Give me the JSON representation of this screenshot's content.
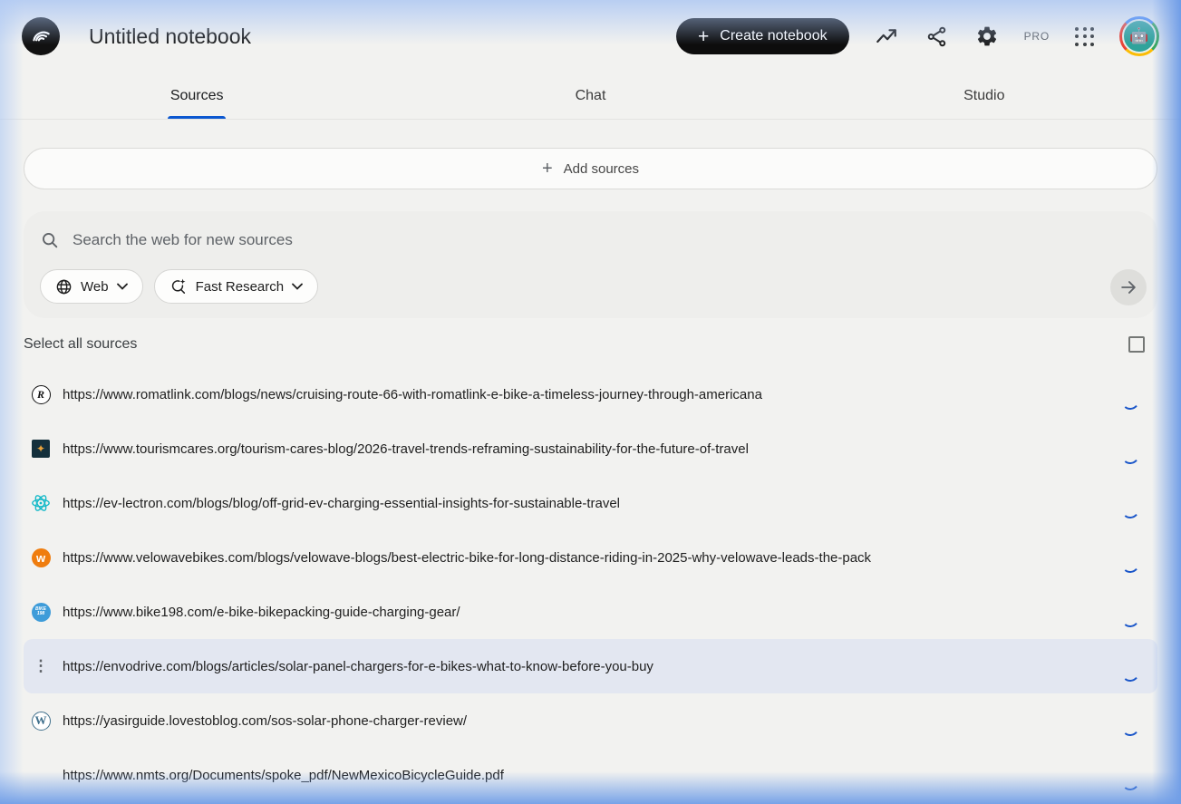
{
  "header": {
    "title": "Untitled notebook",
    "create_button_label": "Create notebook",
    "plus_glyph": "+",
    "pro_label": "PRO",
    "logo_icon": "notebooklm-logo",
    "avatar_icon": "robot-avatar"
  },
  "tabs": [
    {
      "label": "Sources",
      "active": true
    },
    {
      "label": "Chat",
      "active": false
    },
    {
      "label": "Studio",
      "active": false
    }
  ],
  "add_sources": {
    "label": "Add sources",
    "plus_glyph": "+"
  },
  "search": {
    "placeholder": "Search the web for new sources",
    "source_type_chip": {
      "label": "Web",
      "icon": "globe-icon"
    },
    "research_mode_chip": {
      "label": "Fast Research",
      "icon": "sparkle-search-icon"
    },
    "submit_icon": "arrow-right-icon"
  },
  "select_all": {
    "label": "Select all sources"
  },
  "sources": [
    {
      "url": "https://www.romatlink.com/blogs/news/cruising-route-66-with-romatlink-e-bike-a-timeless-journey-through-americana",
      "favicon": "romatlink-logo",
      "state": "loading",
      "hovered": false
    },
    {
      "url": "https://www.tourismcares.org/tourism-cares-blog/2026-travel-trends-reframing-sustainability-for-the-future-of-travel",
      "favicon": "tourismcares-logo",
      "state": "loading",
      "hovered": false
    },
    {
      "url": "https://ev-lectron.com/blogs/blog/off-grid-ev-charging-essential-insights-for-sustainable-travel",
      "favicon": "evlectron-logo",
      "state": "loading",
      "hovered": false
    },
    {
      "url": "https://www.velowavebikes.com/blogs/velowave-blogs/best-electric-bike-for-long-distance-riding-in-2025-why-velowave-leads-the-pack",
      "favicon": "velowave-logo",
      "state": "loading",
      "hovered": false
    },
    {
      "url": "https://www.bike198.com/e-bike-bikepacking-guide-charging-gear/",
      "favicon": "bike198-logo",
      "state": "loading",
      "hovered": false
    },
    {
      "url": "https://envodrive.com/blogs/articles/solar-panel-chargers-for-e-bikes-what-to-know-before-you-buy",
      "favicon": "kebab-menu",
      "state": "loading",
      "hovered": true
    },
    {
      "url": "https://yasirguide.lovestoblog.com/sos-solar-phone-charger-review/",
      "favicon": "wordpress-logo",
      "state": "loading",
      "hovered": false
    },
    {
      "url": "https://www.nmts.org/Documents/spoke_pdf/NewMexicoBicycleGuide.pdf",
      "favicon": "none",
      "state": "loading",
      "hovered": false
    }
  ],
  "colors": {
    "accent_blue": "#0b57d0",
    "spinner_blue": "#1a56c9",
    "create_button_bg": "#0d0d0d",
    "hover_row_bg": "#e3e7f1",
    "edge_glow_blue": "#6f9de7",
    "panel_gray": "#eeeeec"
  }
}
